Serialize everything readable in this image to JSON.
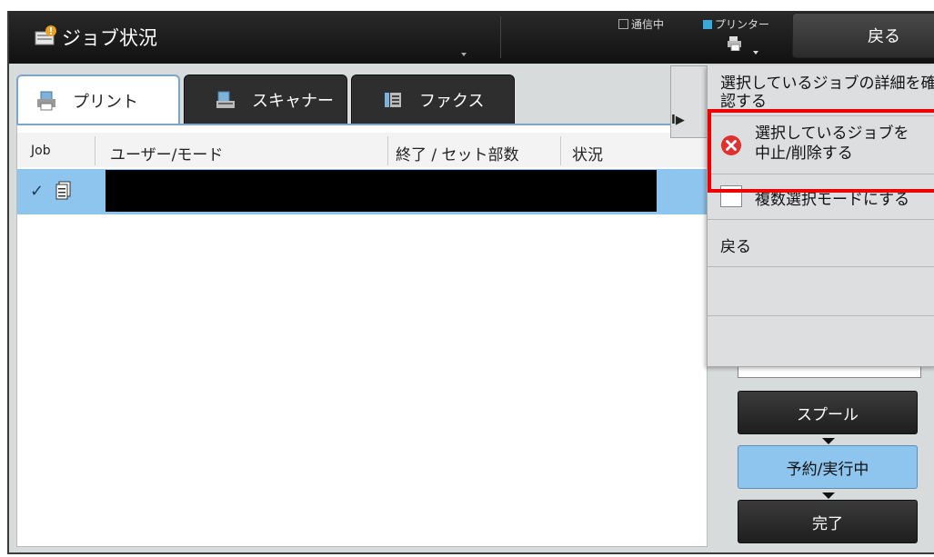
{
  "header": {
    "title": "ジョブ状況",
    "status_comm": "通信中",
    "status_printer": "プリンター",
    "back_label": "戻る"
  },
  "tabs": [
    {
      "label": "プリント",
      "active": true
    },
    {
      "label": "スキャナー",
      "active": false
    },
    {
      "label": "ファクス",
      "active": false
    }
  ],
  "table": {
    "columns": [
      "Job",
      "ユーザー/モード",
      "終了 / セット部数",
      "状況"
    ],
    "rows": [
      {
        "selected": true,
        "check": "✓"
      }
    ]
  },
  "menu": {
    "items": [
      {
        "label": "選択しているジョブの詳細を確認する"
      },
      {
        "label_line1": "選択しているジョブを",
        "label_line2": "中止/削除する",
        "icon": "cancel-icon",
        "highlighted": true
      },
      {
        "label": "複数選択モードにする",
        "icon": "checkbox"
      },
      {
        "label": "戻る"
      }
    ]
  },
  "stages": {
    "spool": "スプール",
    "active": "予約/実行中",
    "done": "完了"
  },
  "colors": {
    "selection": "#8ec5ee",
    "highlight": "#ee0000",
    "cancel_icon": "#e03030",
    "printer_status": "#39a9dc"
  }
}
